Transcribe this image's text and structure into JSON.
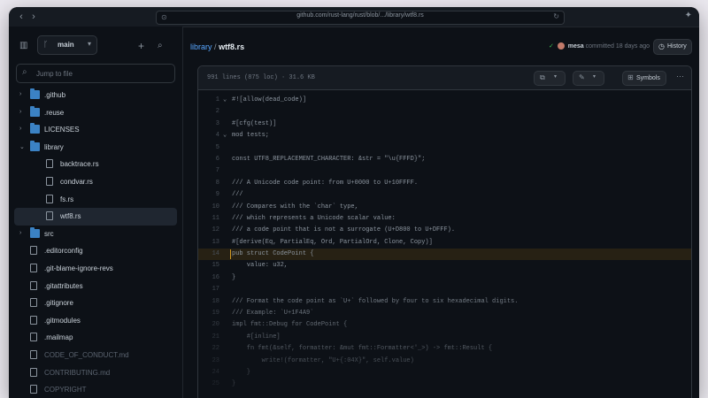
{
  "browser": {
    "url": "github.com/rust-lang/rust/blob/.../library/wtf8.rs"
  },
  "sidebar": {
    "branch": "main",
    "search_placeholder": "Jump to file",
    "tree": [
      {
        "label": ".github",
        "type": "folder",
        "depth": 0,
        "chev": "›",
        "dim": false
      },
      {
        "label": ".reuse",
        "type": "folder",
        "depth": 0,
        "chev": "›",
        "dim": false
      },
      {
        "label": "LICENSES",
        "type": "folder",
        "depth": 0,
        "chev": "›",
        "dim": false
      },
      {
        "label": "library",
        "type": "folder",
        "depth": 0,
        "chev": "⌄",
        "dim": false
      },
      {
        "label": "backtrace.rs",
        "type": "file",
        "depth": 1,
        "chev": "",
        "dim": false
      },
      {
        "label": "condvar.rs",
        "type": "file",
        "depth": 1,
        "chev": "",
        "dim": false
      },
      {
        "label": "fs.rs",
        "type": "file",
        "depth": 1,
        "chev": "",
        "dim": false
      },
      {
        "label": "wtf8.rs",
        "type": "file",
        "depth": 1,
        "chev": "",
        "dim": false,
        "active": true
      },
      {
        "label": "src",
        "type": "folder",
        "depth": 0,
        "chev": "›",
        "dim": false
      },
      {
        "label": ".editorconfig",
        "type": "file",
        "depth": 0,
        "chev": "",
        "dim": false
      },
      {
        "label": ".git-blame-ignore-revs",
        "type": "file",
        "depth": 0,
        "chev": "",
        "dim": false
      },
      {
        "label": ".gitattributes",
        "type": "file",
        "depth": 0,
        "chev": "",
        "dim": false
      },
      {
        "label": ".gitignore",
        "type": "file",
        "depth": 0,
        "chev": "",
        "dim": false
      },
      {
        "label": ".gitmodules",
        "type": "file",
        "depth": 0,
        "chev": "",
        "dim": false
      },
      {
        "label": ".mailmap",
        "type": "file",
        "depth": 0,
        "chev": "",
        "dim": false
      },
      {
        "label": "CODE_OF_CONDUCT.md",
        "type": "file",
        "depth": 0,
        "chev": "",
        "dim": true
      },
      {
        "label": "CONTRIBUTING.md",
        "type": "file",
        "depth": 0,
        "chev": "",
        "dim": true
      },
      {
        "label": "COPYRIGHT",
        "type": "file",
        "depth": 0,
        "chev": "",
        "dim": true
      }
    ]
  },
  "main": {
    "breadcrumb": {
      "root": "library",
      "sep": "/",
      "file": "wtf8.rs"
    },
    "commit": {
      "check": "✓",
      "user": "mesa",
      "text": "committed 18 days ago"
    },
    "history_label": "History",
    "file_stats": "991 lines (875 loc) · 31.6 KB",
    "symbols_label": "Symbols",
    "code": [
      {
        "n": "1",
        "fold": "⌄",
        "t": "#![allow(dead_code)]"
      },
      {
        "n": "2",
        "fold": "",
        "t": ""
      },
      {
        "n": "3",
        "fold": "",
        "t": "#[cfg(test)]"
      },
      {
        "n": "4",
        "fold": "⌄",
        "t": "mod tests;"
      },
      {
        "n": "5",
        "fold": "",
        "t": ""
      },
      {
        "n": "6",
        "fold": "",
        "t": "const UTF8_REPLACEMENT_CHARACTER: &str = \"\\u{FFFD}\";"
      },
      {
        "n": "7",
        "fold": "",
        "t": ""
      },
      {
        "n": "8",
        "fold": "",
        "t": "/// A Unicode code point: from U+0000 to U+10FFFF."
      },
      {
        "n": "9",
        "fold": "",
        "t": "///"
      },
      {
        "n": "10",
        "fold": "",
        "t": "/// Compares with the `char` type,"
      },
      {
        "n": "11",
        "fold": "",
        "t": "/// which represents a Unicode scalar value:"
      },
      {
        "n": "12",
        "fold": "",
        "t": "/// a code point that is not a surrogate (U+D800 to U+DFFF)."
      },
      {
        "n": "13",
        "fold": "",
        "t": "#[derive(Eq, PartialEq, Ord, PartialOrd, Clone, Copy)]"
      },
      {
        "n": "14",
        "fold": "",
        "t": "pub struct CodePoint {",
        "hl": true
      },
      {
        "n": "15",
        "fold": "",
        "t": "    value: u32,"
      },
      {
        "n": "16",
        "fold": "",
        "t": "}"
      },
      {
        "n": "17",
        "fold": "",
        "t": ""
      },
      {
        "n": "18",
        "fold": "",
        "t": "/// Format the code point as `U+` followed by four to six hexadecimal digits."
      },
      {
        "n": "19",
        "fold": "",
        "t": "/// Example: `U+1F4A9`"
      },
      {
        "n": "20",
        "fold": "",
        "t": "impl fmt::Debug for CodePoint {"
      },
      {
        "n": "21",
        "fold": "",
        "t": "    #[inline]"
      },
      {
        "n": "22",
        "fold": "",
        "t": "    fn fmt(&self, formatter: &mut fmt::Formatter<'_>) -> fmt::Result {"
      },
      {
        "n": "23",
        "fold": "",
        "t": "        write!(formatter, \"U+{:04X}\", self.value)"
      },
      {
        "n": "24",
        "fold": "",
        "t": "    }"
      },
      {
        "n": "25",
        "fold": "",
        "t": "}"
      }
    ]
  },
  "colors": {
    "accent": "#58a6ff",
    "highlight": "#d29922",
    "folder": "#3b82c4"
  }
}
